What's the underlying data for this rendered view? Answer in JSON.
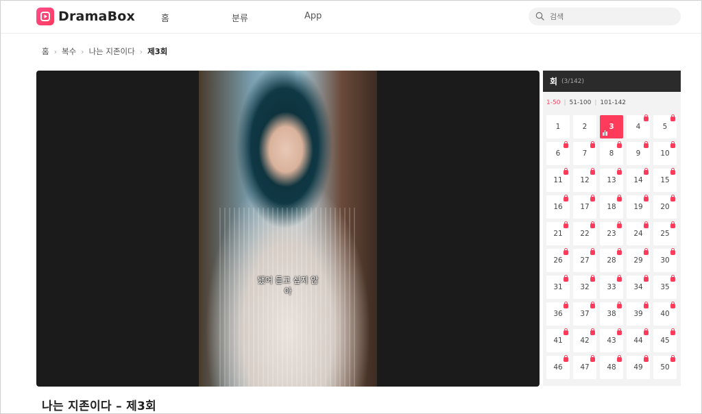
{
  "brand": {
    "name": "DramaBox",
    "icon": "play-logo-icon",
    "accent": "#ff3b5c"
  },
  "nav": [
    {
      "label": "홈"
    },
    {
      "label": "분류"
    },
    {
      "label": "App"
    }
  ],
  "search": {
    "placeholder": "검색",
    "icon": "search-icon"
  },
  "breadcrumb": [
    {
      "label": "홈"
    },
    {
      "label": "복수"
    },
    {
      "label": "나는 지존이다"
    },
    {
      "label": "제3회"
    }
  ],
  "player": {
    "subtitle_line1": "됐어 듣고 싶지 않",
    "subtitle_line2": "아"
  },
  "episodes_panel": {
    "title": "회",
    "count": "(3/142)",
    "ranges": [
      "1-50",
      "51-100",
      "101-142"
    ],
    "active_range": "1-50",
    "current_episode": 3,
    "free_episodes": [
      1,
      2,
      3
    ],
    "episodes": [
      "1",
      "2",
      "3",
      "4",
      "5",
      "6",
      "7",
      "8",
      "9",
      "10",
      "11",
      "12",
      "13",
      "14",
      "15",
      "16",
      "17",
      "18",
      "19",
      "20",
      "21",
      "22",
      "23",
      "24",
      "25",
      "26",
      "27",
      "28",
      "29",
      "30",
      "31",
      "32",
      "33",
      "34",
      "35",
      "36",
      "37",
      "38",
      "39",
      "40",
      "41",
      "42",
      "43",
      "44",
      "45",
      "46",
      "47",
      "48",
      "49",
      "50"
    ]
  },
  "page_title": "나는 지존이다 – 제3회"
}
